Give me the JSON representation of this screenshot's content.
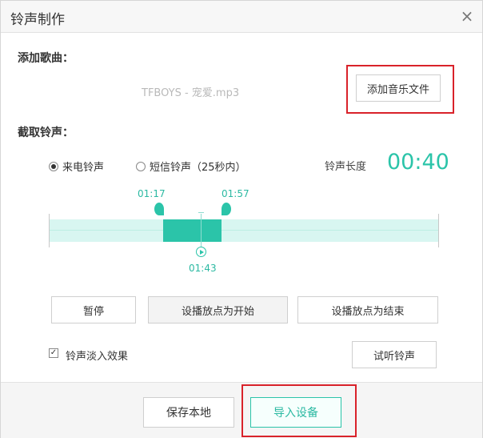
{
  "window": {
    "title": "铃声制作",
    "close_symbol": "×"
  },
  "add_song": {
    "section_label": "添加歌曲：",
    "file_name": "TFBOYS - 宠爱.mp3",
    "add_button": "添加音乐文件"
  },
  "cut": {
    "section_label": "截取铃声：",
    "radio_call": "来电铃声",
    "radio_sms": "短信铃声（25秒内）",
    "selected_radio": "call",
    "length_label": "铃声长度",
    "length_value": "00:40"
  },
  "timeline": {
    "start_time": "01:17",
    "end_time": "01:57",
    "play_time": "01:43"
  },
  "controls": {
    "pause": "暂停",
    "set_start": "设播放点为开始",
    "set_end": "设播放点为结束",
    "fade_in_label": "铃声淡入效果",
    "fade_in_checked": true,
    "check_mark": "✓",
    "preview": "试听铃声"
  },
  "footer": {
    "save_local": "保存本地",
    "import_device": "导入设备"
  },
  "colors": {
    "accent": "#2bc4a9",
    "highlight": "#d9222a"
  }
}
